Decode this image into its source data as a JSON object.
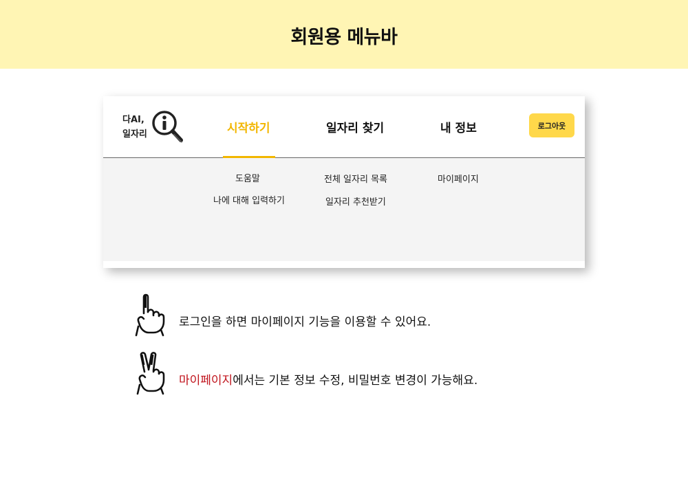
{
  "banner": {
    "title": "회원용 메뉴바"
  },
  "logo": {
    "line1": "다AI,",
    "line2": "일자리",
    "icon": "magnifier-info-icon"
  },
  "nav": {
    "items": [
      {
        "label": "시작하기",
        "active": true
      },
      {
        "label": "일자리 찾기",
        "active": false
      },
      {
        "label": "내 정보",
        "active": false
      }
    ],
    "logout_label": "로그아웃"
  },
  "dropdown": {
    "columns": [
      {
        "items": [
          "도움말",
          "나에 대해 입력하기"
        ]
      },
      {
        "items": [
          "전체 일자리 목록",
          "일자리 추천받기"
        ]
      },
      {
        "items": [
          "마이페이지"
        ]
      }
    ]
  },
  "tips": [
    {
      "icon": "hand-one-finger-icon",
      "highlight": "",
      "text": "로그인을 하면 마이페이지 기능을 이용할 수 있어요."
    },
    {
      "icon": "hand-two-fingers-icon",
      "highlight": "마이페이지",
      "text": "에서는 기본 정보 수정, 비밀번호 변경이 가능해요."
    }
  ],
  "colors": {
    "banner_bg": "#fff5b4",
    "accent": "#f2b600",
    "button_bg": "#ffd84a",
    "dropdown_bg": "#f4f4f4",
    "highlight_text": "#c0121b"
  }
}
